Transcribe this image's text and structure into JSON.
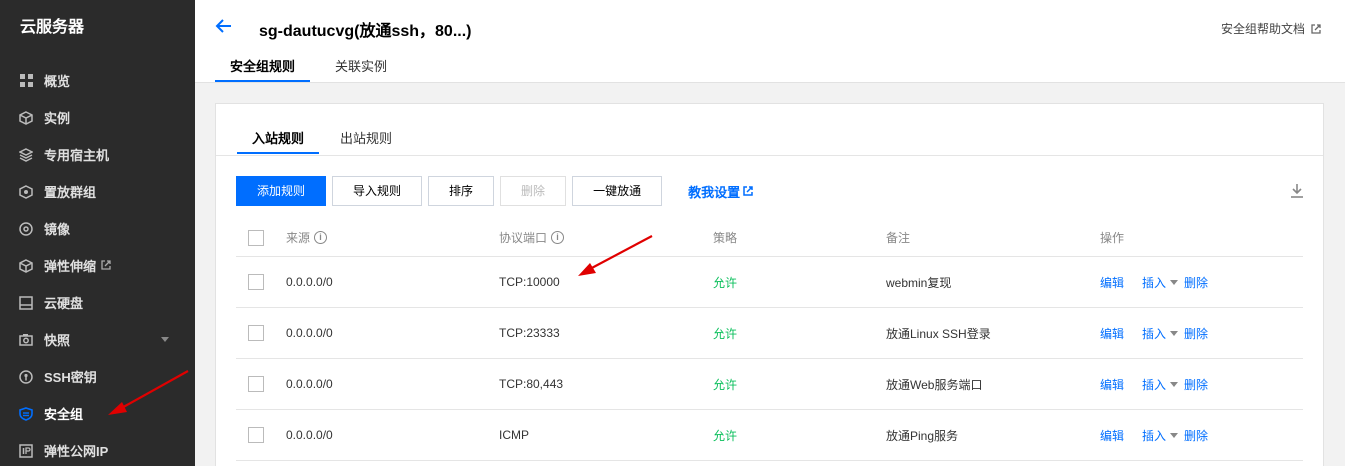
{
  "sidebar": {
    "title": "云服务器",
    "items": [
      {
        "label": "概览",
        "icon": "grid-icon"
      },
      {
        "label": "实例",
        "icon": "cube-icon"
      },
      {
        "label": "专用宿主机",
        "icon": "layers-icon"
      },
      {
        "label": "置放群组",
        "icon": "group-icon"
      },
      {
        "label": "镜像",
        "icon": "disc-icon"
      },
      {
        "label": "弹性伸缩",
        "icon": "scale-icon"
      },
      {
        "label": "云硬盘",
        "icon": "disk-icon"
      },
      {
        "label": "快照",
        "icon": "camera-icon"
      },
      {
        "label": "SSH密钥",
        "icon": "key-icon"
      },
      {
        "label": "安全组",
        "icon": "shield-icon"
      },
      {
        "label": "弹性公网IP",
        "icon": "ip-icon"
      }
    ]
  },
  "header": {
    "title": "sg-dautucvg(放通ssh，80...)",
    "help_link": "安全组帮助文档",
    "tabs": [
      "安全组规则",
      "关联实例"
    ]
  },
  "panel": {
    "tabs": [
      "入站规则",
      "出站规则"
    ],
    "toolbar": {
      "add": "添加规则",
      "import": "导入规则",
      "sort": "排序",
      "delete": "删除",
      "one_click": "一键放通",
      "teach": "教我设置"
    },
    "columns": {
      "source": "来源",
      "protocol": "协议端口",
      "policy": "策略",
      "remark": "备注",
      "ops": "操作"
    },
    "rows": [
      {
        "source": "0.0.0.0/0",
        "protocol": "TCP:10000",
        "policy": "允许",
        "remark": "webmin复现",
        "edit": "编辑",
        "insert": "插入",
        "del": "删除"
      },
      {
        "source": "0.0.0.0/0",
        "protocol": "TCP:23333",
        "policy": "允许",
        "remark": "放通Linux SSH登录",
        "edit": "编辑",
        "insert": "插入",
        "del": "删除"
      },
      {
        "source": "0.0.0.0/0",
        "protocol": "TCP:80,443",
        "policy": "允许",
        "remark": "放通Web服务端口",
        "edit": "编辑",
        "insert": "插入",
        "del": "删除"
      },
      {
        "source": "0.0.0.0/0",
        "protocol": "ICMP",
        "policy": "允许",
        "remark": "放通Ping服务",
        "edit": "编辑",
        "insert": "插入",
        "del": "删除"
      }
    ]
  },
  "colors": {
    "accent": "#006eff",
    "sidebar_bg": "#2b2b2b",
    "allow": "#0abf5b",
    "annotation": "#e00000"
  }
}
